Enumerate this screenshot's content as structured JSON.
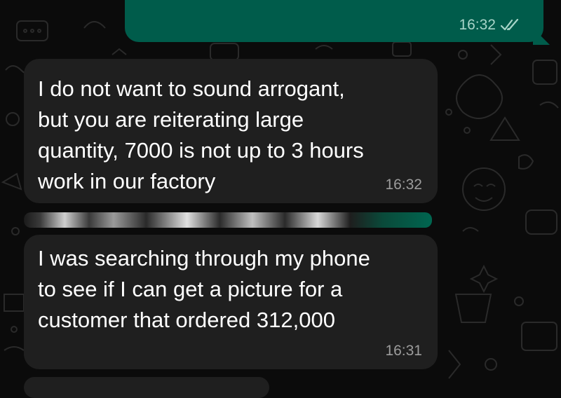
{
  "colors": {
    "background": "#0b0b0b",
    "sent_bubble": "#005c4b",
    "received_bubble": "#1f1f1f",
    "message_text": "#ffffff",
    "timestamp_text": "#9c9c9c",
    "read_receipt": "#a9d5c9"
  },
  "icons": {
    "read_receipt": "double-check-icon"
  },
  "chat": {
    "sent_message": {
      "time": "16:32",
      "status": "read"
    },
    "received_messages": [
      {
        "text": "I do not want to sound arrogant,\nbut you are reiterating large\nquantity, 7000 is not up to 3 hours\nwork in our factory",
        "time": "16:32"
      },
      {
        "text": "I was searching through my phone\nto see if I can get a picture for a\ncustomer that ordered 312,000",
        "time": "16:31"
      }
    ]
  }
}
